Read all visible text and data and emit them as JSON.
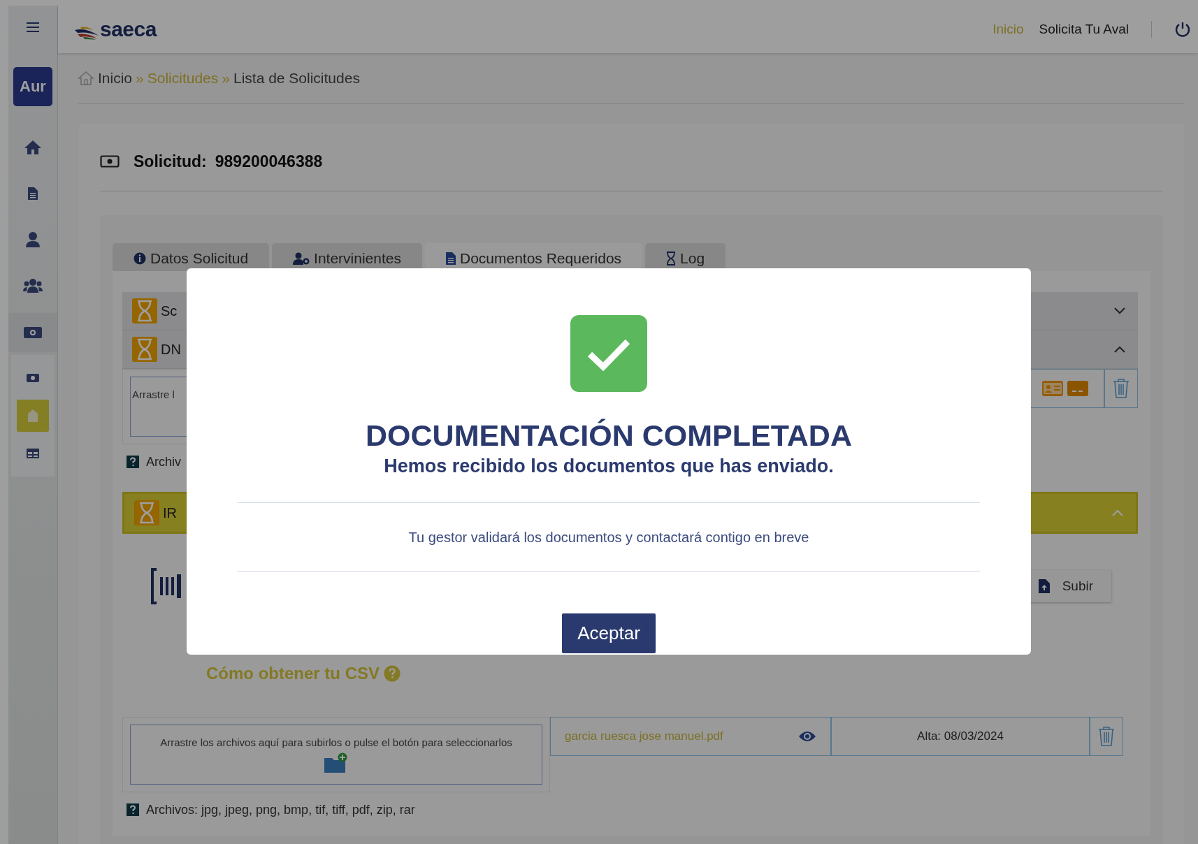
{
  "topbar": {
    "logo": "saeca",
    "nav": [
      {
        "label": "Inicio",
        "selected": true
      },
      {
        "label": "Solicita Tu Aval",
        "selected": false
      }
    ]
  },
  "sidebar": {
    "user_badge": "Aur",
    "items": [
      {
        "kind": "home",
        "selected": false
      },
      {
        "kind": "document",
        "selected": false
      },
      {
        "kind": "person",
        "selected": false
      },
      {
        "kind": "people",
        "selected": false
      },
      {
        "kind": "money",
        "selected": true
      }
    ],
    "subitems": [
      {
        "kind": "money",
        "selected": false
      },
      {
        "kind": "building",
        "selected": true
      },
      {
        "kind": "table",
        "selected": false
      }
    ]
  },
  "breadcrumb": {
    "separator": "»",
    "items": [
      {
        "label": "Inicio",
        "link": false
      },
      {
        "label": "Solicitudes",
        "link": true
      },
      {
        "label": "Lista de Solicitudes",
        "link": false
      }
    ]
  },
  "request": {
    "label": "Solicitud:",
    "number": "989200046388"
  },
  "tabs": [
    {
      "label": "Datos Solicitud",
      "kind": "info",
      "selected": false
    },
    {
      "label": "Intervinientes",
      "kind": "users",
      "selected": false
    },
    {
      "label": "Documentos Requeridos",
      "kind": "document",
      "selected": true
    },
    {
      "label": "Log",
      "kind": "hourglass",
      "selected": false
    }
  ],
  "sections": [
    {
      "title": "Sc",
      "expanded": false,
      "highlighted": false
    },
    {
      "kind": "file",
      "title": "DN",
      "expanded": true,
      "highlighted": false,
      "dropzone": "Arrastre l",
      "note": "Archiv"
    },
    {
      "kind": "csv",
      "title": "IR",
      "expanded": true,
      "highlighted": true,
      "upload_button": "Subir",
      "help_link": "Cómo obtener tu CSV",
      "dropzone": "Arrastre los archivos aquí para subirlos o pulse el botón para seleccionarlos",
      "file_name": "garcia ruesca jose manuel.pdf",
      "file_date": "Alta: 08/03/2024",
      "note": "Archivos: jpg, jpeg, png, bmp, tif, tiff, pdf, zip, rar"
    }
  ],
  "modal": {
    "title": "DOCUMENTACIÓN COMPLETADA",
    "subtitle": "Hemos recibido los documentos que has enviado.",
    "message": "Tu gestor validará los documentos y contactará contigo en breve",
    "button": "Aceptar"
  }
}
